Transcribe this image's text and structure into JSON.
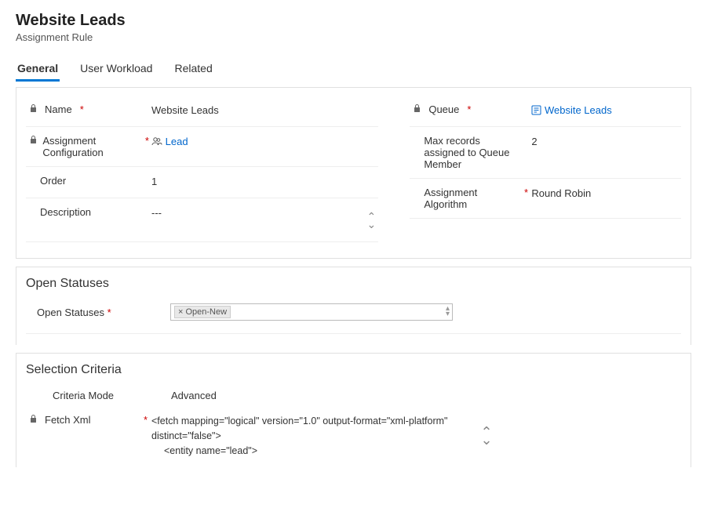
{
  "header": {
    "title": "Website Leads",
    "subtitle": "Assignment Rule"
  },
  "tabs": [
    {
      "label": "General",
      "active": true
    },
    {
      "label": "User Workload",
      "active": false
    },
    {
      "label": "Related",
      "active": false
    }
  ],
  "general": {
    "name": {
      "label": "Name",
      "value": "Website Leads"
    },
    "assignment_configuration": {
      "label": "Assignment Configuration",
      "value": "Lead"
    },
    "order": {
      "label": "Order",
      "value": "1"
    },
    "description": {
      "label": "Description",
      "value": "---"
    },
    "queue": {
      "label": "Queue",
      "value": "Website Leads"
    },
    "max_records": {
      "label": "Max records assigned to Queue Member",
      "value": "2"
    },
    "assignment_algorithm": {
      "label": "Assignment Algorithm",
      "value": "Round Robin"
    }
  },
  "open_statuses": {
    "section_title": "Open Statuses",
    "field_label": "Open Statuses",
    "tag": "× Open-New"
  },
  "selection_criteria": {
    "section_title": "Selection Criteria",
    "criteria_mode": {
      "label": "Criteria Mode",
      "value": "Advanced"
    },
    "fetch_xml": {
      "label": "Fetch Xml",
      "line1": "<fetch mapping=\"logical\" version=\"1.0\" output-format=\"xml-platform\" distinct=\"false\">",
      "line2": "<entity name=\"lead\">"
    }
  }
}
